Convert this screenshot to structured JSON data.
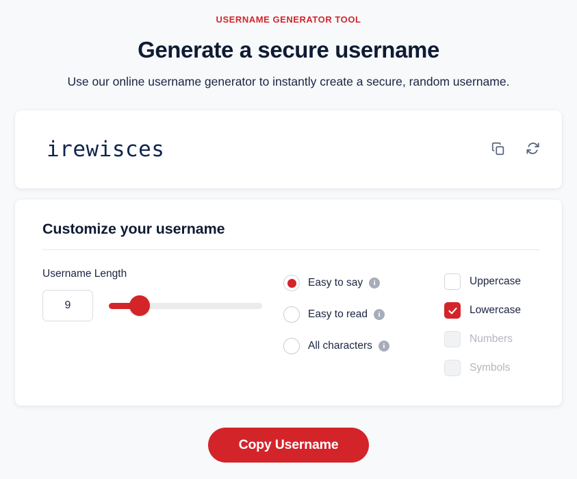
{
  "header": {
    "eyebrow": "USERNAME GENERATOR TOOL",
    "headline": "Generate a secure username",
    "subhead": "Use our online username generator to instantly create a secure, random username."
  },
  "result": {
    "username": "irewisces",
    "copy_icon": "copy-icon",
    "refresh_icon": "refresh-icon"
  },
  "customize": {
    "title": "Customize your username",
    "length": {
      "label": "Username Length",
      "value": "9",
      "slider_percent": 20
    },
    "character_style": {
      "options": [
        {
          "label": "Easy to say",
          "selected": true,
          "info": "i"
        },
        {
          "label": "Easy to read",
          "selected": false,
          "info": "i"
        },
        {
          "label": "All characters",
          "selected": false,
          "info": "i"
        }
      ]
    },
    "character_sets": {
      "options": [
        {
          "label": "Uppercase",
          "checked": false,
          "disabled": false
        },
        {
          "label": "Lowercase",
          "checked": true,
          "disabled": false
        },
        {
          "label": "Numbers",
          "checked": false,
          "disabled": true
        },
        {
          "label": "Symbols",
          "checked": false,
          "disabled": true
        }
      ]
    }
  },
  "footer": {
    "copy_button": "Copy Username"
  },
  "colors": {
    "brand_red": "#d3242a",
    "headline_navy": "#101b33",
    "page_background": "#f7f9fb",
    "card_background": "#ffffff",
    "icon_slate": "#57637a",
    "disabled_text": "#b2b6bf"
  }
}
